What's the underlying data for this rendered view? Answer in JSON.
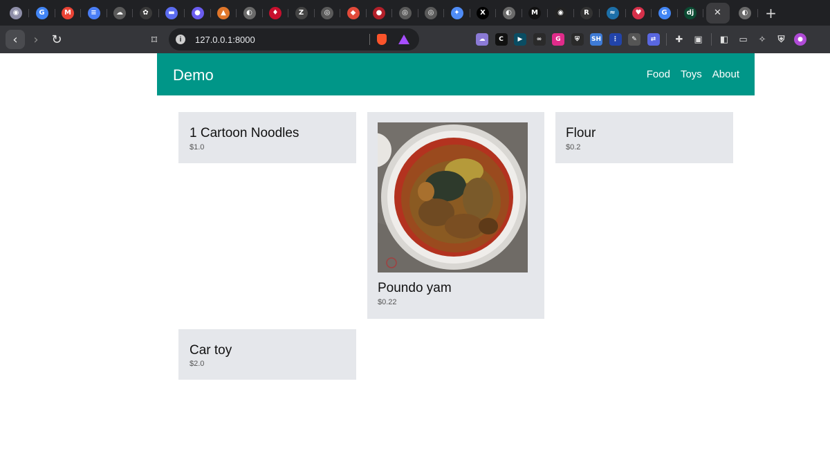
{
  "browser": {
    "url": "127.0.0.1:8000",
    "tab_close_glyph": "✕",
    "new_tab_glyph": "+",
    "tabs": [
      {
        "icon": "circle-user-icon",
        "glyph": "◉",
        "color": "#8e8ea8"
      },
      {
        "icon": "google-icon",
        "glyph": "G",
        "color": "#4285f4"
      },
      {
        "icon": "gmail-icon",
        "glyph": "M",
        "color": "#ea4335"
      },
      {
        "icon": "docs-icon",
        "glyph": "≡",
        "color": "#4a7ef5"
      },
      {
        "icon": "cloud-icon",
        "glyph": "☁",
        "color": "#5a5a5a"
      },
      {
        "icon": "openai-icon",
        "glyph": "✿",
        "color": "#3a3a3a"
      },
      {
        "icon": "screen-icon",
        "glyph": "▬",
        "color": "#5b6cf0"
      },
      {
        "icon": "ai-orb-icon",
        "glyph": "●",
        "color": "#6a5cf0"
      },
      {
        "icon": "fox-icon",
        "glyph": "▲",
        "color": "#e0762a"
      },
      {
        "icon": "globe-icon",
        "glyph": "◐",
        "color": "#6a6a6a"
      },
      {
        "icon": "drop-icon",
        "glyph": "♦",
        "color": "#c8102e"
      },
      {
        "icon": "z-icon",
        "glyph": "Z",
        "color": "#444"
      },
      {
        "icon": "compass-icon",
        "glyph": "◎",
        "color": "#5a5a5a"
      },
      {
        "icon": "colorful-icon",
        "glyph": "◆",
        "color": "#e24a3a"
      },
      {
        "icon": "red-circle-icon",
        "glyph": "●",
        "color": "#b3202a"
      },
      {
        "icon": "chat-icon",
        "glyph": "◎",
        "color": "#5a5a5a"
      },
      {
        "icon": "chat-icon",
        "glyph": "◎",
        "color": "#5a5a5a"
      },
      {
        "icon": "gemini-icon",
        "glyph": "✦",
        "color": "#4f8cf7"
      },
      {
        "icon": "x-icon",
        "glyph": "X",
        "color": "#000"
      },
      {
        "icon": "globe-icon",
        "glyph": "◐",
        "color": "#6a6a6a"
      },
      {
        "icon": "medium-icon",
        "glyph": "M",
        "color": "#111"
      },
      {
        "icon": "github-icon",
        "glyph": "◉",
        "color": "#222"
      },
      {
        "icon": "record-icon",
        "glyph": "R",
        "color": "#333"
      },
      {
        "icon": "wave-icon",
        "glyph": "≈",
        "color": "#1c6fa8"
      },
      {
        "icon": "heart-icon",
        "glyph": "♥",
        "color": "#d6304a"
      },
      {
        "icon": "google-icon",
        "glyph": "G",
        "color": "#4285f4"
      },
      {
        "icon": "django-icon",
        "glyph": "dj",
        "color": "#0c4b33"
      },
      {
        "icon": "close-icon",
        "glyph": "✕",
        "color": "#3c3c3f",
        "active": true
      },
      {
        "icon": "globe-icon",
        "glyph": "◐",
        "color": "#6a6a6a"
      }
    ],
    "extensions": [
      {
        "icon": "cloud-ext-icon",
        "glyph": "☁",
        "color": "#8b7ad6"
      },
      {
        "icon": "c-ext-icon",
        "glyph": "C",
        "color": "#111"
      },
      {
        "icon": "play-ext-icon",
        "glyph": "▶",
        "color": "#0a4d63"
      },
      {
        "icon": "link-ext-icon",
        "glyph": "∞",
        "color": "#2a2a2a"
      },
      {
        "icon": "g-ext-icon",
        "glyph": "G",
        "color": "#e02b8a"
      },
      {
        "icon": "shield-ext-icon",
        "glyph": "⛨",
        "color": "#2a2a2a"
      },
      {
        "icon": "sh-ext-icon",
        "glyph": "SH",
        "color": "#3e7bd6"
      },
      {
        "icon": "dots-ext-icon",
        "glyph": "⋮",
        "color": "#2244aa"
      },
      {
        "icon": "feather-ext-icon",
        "glyph": "✎",
        "color": "#555"
      },
      {
        "icon": "translate-ext-icon",
        "glyph": "⇄",
        "color": "#5967e0"
      },
      {
        "icon": "puzzle-icon",
        "glyph": "✚",
        "color": "#555"
      },
      {
        "icon": "reader-icon",
        "glyph": "▣",
        "color": "#555"
      },
      {
        "icon": "sidebar-icon",
        "glyph": "◧",
        "color": "#555"
      },
      {
        "icon": "wallet-icon",
        "glyph": "▭",
        "color": "#555"
      },
      {
        "icon": "sparkle-icon",
        "glyph": "✧",
        "color": "#555"
      },
      {
        "icon": "brave-shield-icon",
        "glyph": "⛨",
        "color": "#555"
      },
      {
        "icon": "profile-icon",
        "glyph": "●",
        "color": "#b04bd6"
      }
    ]
  },
  "nav": {
    "brand": "Demo",
    "links": [
      "Food",
      "Toys",
      "About"
    ]
  },
  "products": [
    {
      "name": "1 Cartoon Noodles",
      "price": "$1.0",
      "has_image": false
    },
    {
      "name": "Poundo yam",
      "price": "$0.22",
      "has_image": true
    },
    {
      "name": "Flour",
      "price": "$0.2",
      "has_image": false
    },
    {
      "name": "Car toy",
      "price": "$2.0",
      "has_image": false
    }
  ]
}
